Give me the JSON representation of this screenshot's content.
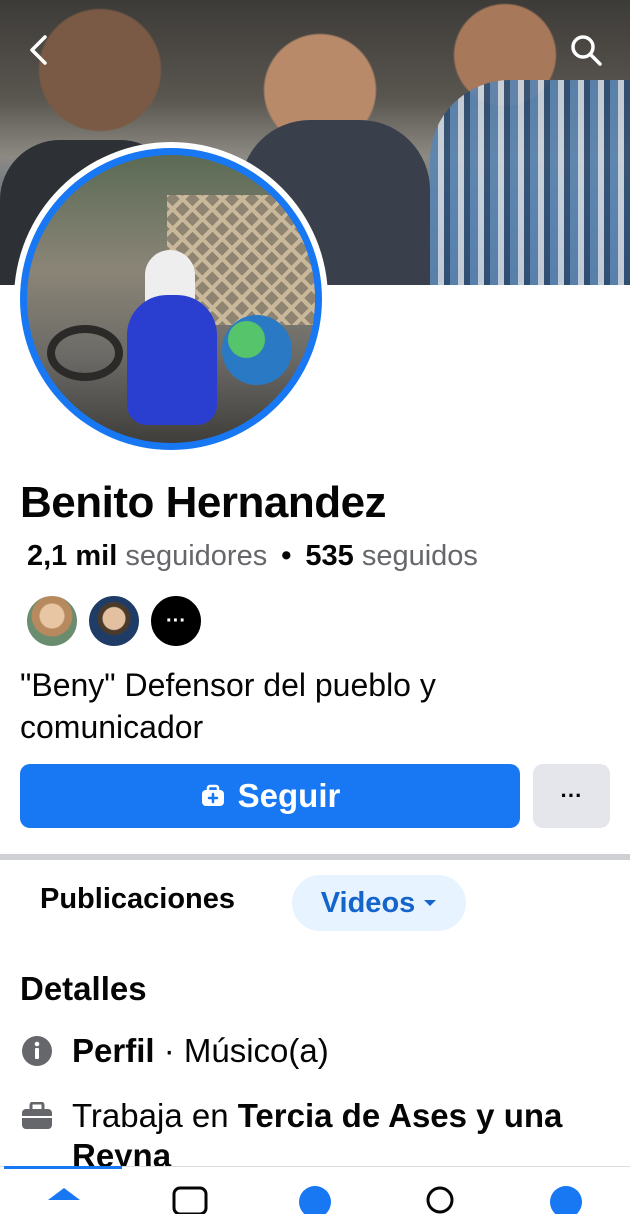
{
  "profile": {
    "name": "Benito Hernandez",
    "followers_count": "2,1 mil",
    "followers_label": "seguidores",
    "following_count": "535",
    "following_label": "seguidos",
    "bio": "\"Beny\" Defensor del pueblo y comunicador",
    "mutual_more": "···"
  },
  "actions": {
    "follow_label": "Seguir",
    "more_label": "···"
  },
  "tabs": {
    "posts_label": "Publicaciones",
    "videos_label": "Videos"
  },
  "details": {
    "heading": "Detalles",
    "profile_label": "Perfil",
    "profile_value": " · Músico(a)",
    "work_prefix": "Trabaja en ",
    "work_place": "Tercia de Ases y una Reyna"
  },
  "colors": {
    "accent": "#1877f2",
    "muted": "#65676b",
    "chip_bg": "#e7f3ff"
  },
  "icons": [
    "back-icon",
    "search-icon",
    "follow-icon",
    "chevron-down-icon",
    "info-icon",
    "briefcase-icon"
  ]
}
